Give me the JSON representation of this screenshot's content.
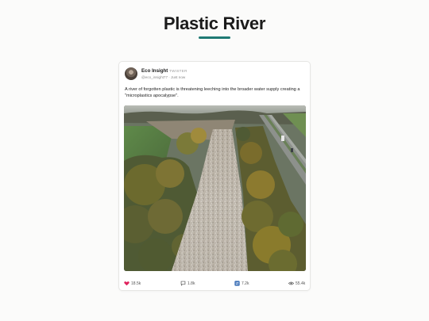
{
  "page": {
    "title": "Plastic River",
    "accent": "#1f7a74"
  },
  "post": {
    "author": "Eco Insight",
    "platform": "TWISTER",
    "handle_time": "@eco_insight77 · Just now",
    "text": "A river of forgotten plastic is threatening leeching into the broader water supply creating a \"microplastics apocalypse\".",
    "media": {
      "kind": "aerial photo",
      "icon": "image"
    },
    "stats": {
      "likes": "18.5k",
      "comments": "1.8k",
      "reposts": "7.2k",
      "views": "55.4k"
    },
    "icons": {
      "likes": "heart-icon",
      "comments": "comment-icon",
      "reposts": "repost-icon",
      "views": "eye-icon"
    },
    "colors": {
      "like": "#e0245e",
      "repost": "#3b6fb6"
    }
  }
}
